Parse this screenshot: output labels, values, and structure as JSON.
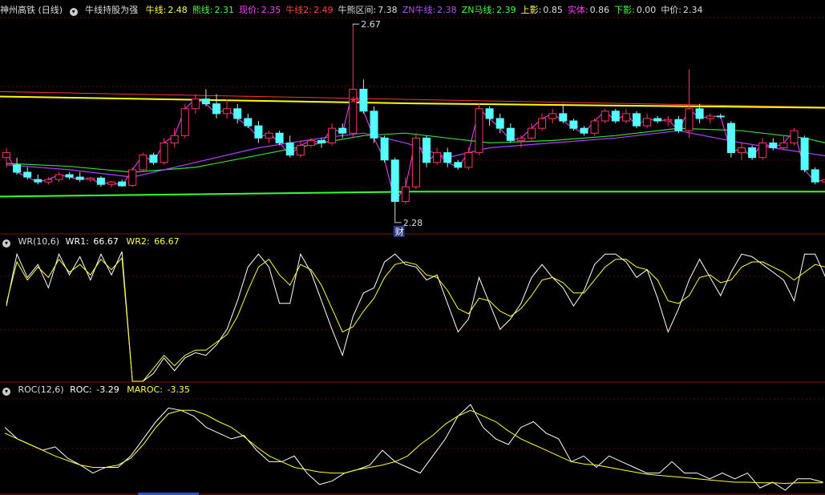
{
  "main_legend": {
    "stock_name": "神州高铁 (日线)",
    "indicator_name": "牛线持股为强",
    "items": [
      {
        "label": "牛线:",
        "value": "2.48",
        "label_color": "#ffff40",
        "value_color": "#ffff40"
      },
      {
        "label": "熊线:",
        "value": "2.31",
        "label_color": "#40ff40",
        "value_color": "#40ff40"
      },
      {
        "label": "现价:",
        "value": "2.35",
        "label_color": "#ff40ff",
        "value_color": "#ff40ff"
      },
      {
        "label": "牛线2:",
        "value": "2.49",
        "label_color": "#ff4040",
        "value_color": "#ff4040"
      },
      {
        "label": "牛熊区间:",
        "value": "7.38",
        "label_color": "#dddddd",
        "value_color": "#dddddd"
      },
      {
        "label": "ZN牛线:",
        "value": "2.38",
        "label_color": "#b050ff",
        "value_color": "#b050ff"
      },
      {
        "label": "ZN马线:",
        "value": "2.39",
        "label_color": "#40ff40",
        "value_color": "#40ff40"
      },
      {
        "label": "上影:",
        "value": "0.85",
        "label_color": "#ffff40",
        "value_color": "#dddddd"
      },
      {
        "label": "实体:",
        "value": "0.86",
        "label_color": "#ff40ff",
        "value_color": "#dddddd"
      },
      {
        "label": "下影:",
        "value": "0.00",
        "label_color": "#40ff40",
        "value_color": "#dddddd"
      },
      {
        "label": "中价:",
        "value": "2.34",
        "label_color": "#dddddd",
        "value_color": "#dddddd"
      }
    ],
    "high_marker": "2.67",
    "low_marker": "2.28",
    "low_tag": "财"
  },
  "wr_legend": {
    "name": "WR(10,6)",
    "wr1_label": "WR1:",
    "wr1_value": "66.67",
    "wr2_label": "WR2:",
    "wr2_value": "66.67"
  },
  "roc_legend": {
    "name": "ROC(12,6)",
    "roc_label": "ROC:",
    "roc_value": "-3.29",
    "maroc_label": "MAROC:",
    "maroc_value": "-3.35"
  },
  "colors": {
    "up": "#ff3366",
    "down": "#54ffff",
    "bull": "#ffff00",
    "bull2": "#ff3333",
    "bear": "#33ff33",
    "zn_bull": "#b040ff",
    "zn_horse": "#33dd33",
    "wr1": "#ffffff",
    "wr2": "#ffff33",
    "roc": "#ffffff",
    "maroc": "#ffff33"
  },
  "chart_data": [
    {
      "type": "candlestick",
      "ylim": [
        2.26,
        2.69
      ],
      "candles": [
        [
          2.4,
          2.42,
          2.38,
          2.41
        ],
        [
          2.385,
          2.4,
          2.365,
          2.37
        ],
        [
          2.37,
          2.38,
          2.355,
          2.36
        ],
        [
          2.355,
          2.365,
          2.345,
          2.35
        ],
        [
          2.35,
          2.36,
          2.345,
          2.355
        ],
        [
          2.355,
          2.37,
          2.35,
          2.365
        ],
        [
          2.365,
          2.37,
          2.355,
          2.36
        ],
        [
          2.36,
          2.37,
          2.35,
          2.355
        ],
        [
          2.355,
          2.36,
          2.35,
          2.358
        ],
        [
          2.358,
          2.362,
          2.34,
          2.345
        ],
        [
          2.345,
          2.352,
          2.338,
          2.35
        ],
        [
          2.35,
          2.355,
          2.34,
          2.342
        ],
        [
          2.343,
          2.38,
          2.34,
          2.375
        ],
        [
          2.375,
          2.41,
          2.37,
          2.405
        ],
        [
          2.405,
          2.41,
          2.385,
          2.39
        ],
        [
          2.39,
          2.44,
          2.385,
          2.43
        ],
        [
          2.43,
          2.46,
          2.42,
          2.445
        ],
        [
          2.445,
          2.51,
          2.44,
          2.5
        ],
        [
          2.5,
          2.53,
          2.49,
          2.52
        ],
        [
          2.52,
          2.54,
          2.505,
          2.51
        ],
        [
          2.51,
          2.53,
          2.48,
          2.49
        ],
        [
          2.49,
          2.52,
          2.48,
          2.5
        ],
        [
          2.5,
          2.51,
          2.47,
          2.48
        ],
        [
          2.48,
          2.49,
          2.46,
          2.465
        ],
        [
          2.465,
          2.475,
          2.43,
          2.44
        ],
        [
          2.44,
          2.455,
          2.43,
          2.45
        ],
        [
          2.45,
          2.455,
          2.425,
          2.43
        ],
        [
          2.43,
          2.445,
          2.4,
          2.405
        ],
        [
          2.405,
          2.435,
          2.4,
          2.425
        ],
        [
          2.425,
          2.44,
          2.42,
          2.435
        ],
        [
          2.435,
          2.44,
          2.42,
          2.43
        ],
        [
          2.43,
          2.47,
          2.425,
          2.46
        ],
        [
          2.46,
          2.47,
          2.44,
          2.45
        ],
        [
          2.45,
          2.67,
          2.44,
          2.54
        ],
        [
          2.54,
          2.56,
          2.49,
          2.495
        ],
        [
          2.495,
          2.505,
          2.43,
          2.44
        ],
        [
          2.44,
          2.445,
          2.39,
          2.395
        ],
        [
          2.395,
          2.4,
          2.28,
          2.31
        ],
        [
          2.31,
          2.36,
          2.305,
          2.34
        ],
        [
          2.34,
          2.45,
          2.335,
          2.44
        ],
        [
          2.44,
          2.445,
          2.38,
          2.39
        ],
        [
          2.39,
          2.42,
          2.385,
          2.41
        ],
        [
          2.41,
          2.42,
          2.38,
          2.39
        ],
        [
          2.39,
          2.395,
          2.375,
          2.38
        ],
        [
          2.38,
          2.42,
          2.375,
          2.41
        ],
        [
          2.41,
          2.51,
          2.405,
          2.5
        ],
        [
          2.5,
          2.505,
          2.465,
          2.48
        ],
        [
          2.48,
          2.49,
          2.45,
          2.46
        ],
        [
          2.46,
          2.47,
          2.43,
          2.435
        ],
        [
          2.435,
          2.445,
          2.42,
          2.44
        ],
        [
          2.44,
          2.47,
          2.435,
          2.46
        ],
        [
          2.46,
          2.49,
          2.455,
          2.48
        ],
        [
          2.48,
          2.5,
          2.47,
          2.49
        ],
        [
          2.49,
          2.51,
          2.47,
          2.475
        ],
        [
          2.475,
          2.48,
          2.455,
          2.46
        ],
        [
          2.46,
          2.465,
          2.445,
          2.45
        ],
        [
          2.45,
          2.48,
          2.445,
          2.475
        ],
        [
          2.475,
          2.5,
          2.47,
          2.495
        ],
        [
          2.495,
          2.5,
          2.47,
          2.475
        ],
        [
          2.475,
          2.5,
          2.47,
          2.49
        ],
        [
          2.49,
          2.495,
          2.46,
          2.465
        ],
        [
          2.465,
          2.49,
          2.46,
          2.48
        ],
        [
          2.48,
          2.485,
          2.47,
          2.475
        ],
        [
          2.475,
          2.485,
          2.465,
          2.478
        ],
        [
          2.478,
          2.485,
          2.45,
          2.455
        ],
        [
          2.455,
          2.58,
          2.44,
          2.5
        ],
        [
          2.5,
          2.51,
          2.47,
          2.48
        ],
        [
          2.48,
          2.49,
          2.47,
          2.485
        ],
        [
          2.485,
          2.49,
          2.48,
          2.484
        ],
        [
          2.47,
          2.475,
          2.4,
          2.41
        ],
        [
          2.41,
          2.43,
          2.395,
          2.42
        ],
        [
          2.42,
          2.425,
          2.395,
          2.4
        ],
        [
          2.4,
          2.44,
          2.395,
          2.43
        ],
        [
          2.43,
          2.44,
          2.415,
          2.42
        ],
        [
          2.42,
          2.445,
          2.415,
          2.43
        ],
        [
          2.43,
          2.46,
          2.425,
          2.455
        ],
        [
          2.44,
          2.445,
          2.37,
          2.375
        ],
        [
          2.375,
          2.38,
          2.345,
          2.35
        ],
        [
          2.35,
          2.36,
          2.345,
          2.355
        ],
        [
          2.355,
          2.4,
          2.35,
          2.38
        ]
      ],
      "bull_line": [
        2.525,
        2.511,
        2.502
      ],
      "bull_line2": [
        2.535,
        2.519,
        2.503
      ],
      "bear_line": [
        2.32,
        2.33,
        2.33
      ],
      "zn_bull_points": [
        [
          0,
          2.385
        ],
        [
          6,
          2.375
        ],
        [
          12,
          2.36
        ],
        [
          18,
          2.39
        ],
        [
          24,
          2.42
        ],
        [
          30,
          2.44
        ],
        [
          34,
          2.45
        ],
        [
          38,
          2.43
        ],
        [
          42,
          2.4
        ],
        [
          46,
          2.42
        ],
        [
          52,
          2.43
        ],
        [
          58,
          2.44
        ],
        [
          64,
          2.455
        ],
        [
          70,
          2.43
        ],
        [
          76,
          2.41
        ],
        [
          79,
          2.4
        ]
      ],
      "zn_horse_points": [
        [
          0,
          2.388
        ],
        [
          6,
          2.382
        ],
        [
          12,
          2.37
        ],
        [
          18,
          2.38
        ],
        [
          24,
          2.405
        ],
        [
          30,
          2.43
        ],
        [
          34,
          2.445
        ],
        [
          38,
          2.45
        ],
        [
          42,
          2.44
        ],
        [
          46,
          2.43
        ],
        [
          52,
          2.435
        ],
        [
          58,
          2.445
        ],
        [
          64,
          2.46
        ],
        [
          70,
          2.455
        ],
        [
          76,
          2.44
        ],
        [
          79,
          2.425
        ]
      ]
    },
    {
      "type": "line",
      "ylim": [
        0,
        100
      ],
      "series": [
        {
          "name": "WR1",
          "values": [
            58,
            98,
            80,
            90,
            72,
            98,
            82,
            96,
            78,
            98,
            82,
            100,
            0,
            0,
            6,
            18,
            8,
            18,
            22,
            20,
            28,
            40,
            62,
            88,
            98,
            88,
            60,
            60,
            98,
            84,
            62,
            40,
            20,
            50,
            68,
            72,
            92,
            98,
            90,
            88,
            78,
            82,
            60,
            38,
            48,
            80,
            60,
            40,
            48,
            60,
            80,
            90,
            80,
            72,
            58,
            70,
            90,
            98,
            98,
            92,
            80,
            86,
            64,
            38,
            56,
            78,
            94,
            80,
            66,
            84,
            98,
            96,
            90,
            84,
            78,
            62,
            98,
            98,
            80,
            70
          ]
        },
        {
          "name": "WR2",
          "values": [
            60,
            92,
            78,
            88,
            80,
            94,
            84,
            90,
            82,
            94,
            86,
            95,
            0,
            0,
            10,
            20,
            12,
            20,
            24,
            24,
            30,
            36,
            50,
            70,
            88,
            94,
            82,
            74,
            90,
            86,
            74,
            56,
            38,
            42,
            54,
            64,
            80,
            90,
            92,
            90,
            82,
            80,
            70,
            56,
            52,
            64,
            62,
            54,
            50,
            56,
            66,
            78,
            80,
            76,
            68,
            68,
            78,
            88,
            94,
            94,
            88,
            86,
            78,
            62,
            60,
            66,
            80,
            82,
            76,
            78,
            88,
            92,
            92,
            88,
            84,
            78,
            84,
            90,
            88,
            80
          ]
        }
      ]
    },
    {
      "type": "line",
      "ylim": [
        -4,
        4
      ],
      "series": [
        {
          "name": "ROC",
          "values": [
            1.5,
            0.5,
            0.0,
            -0.5,
            -0.2,
            -1.2,
            -1.8,
            -2.5,
            -2.0,
            -2.0,
            -1.0,
            0.5,
            2.0,
            3.2,
            3.0,
            2.5,
            1.5,
            1.0,
            0.5,
            0.8,
            -0.5,
            -1.5,
            -1.5,
            -1.0,
            -2.5,
            -3.5,
            -3.2,
            -2.5,
            -2.2,
            -1.8,
            -0.5,
            -1.5,
            -2.0,
            -2.5,
            -1.0,
            0.5,
            2.5,
            3.5,
            1.5,
            0.5,
            0.0,
            1.5,
            2.0,
            1.0,
            0.5,
            -1.5,
            -1.0,
            -2.0,
            -1.0,
            -1.5,
            -2.0,
            -2.5,
            -2.5,
            -1.5,
            -2.5,
            -2.5,
            -3.0,
            -2.5,
            -3.0,
            -2.5,
            -3.8,
            -3.3,
            -4.0,
            -3.0,
            -3.0,
            -3.3
          ]
        },
        {
          "name": "MAROC",
          "values": [
            1.0,
            0.5,
            0.0,
            -0.5,
            -1.0,
            -1.4,
            -1.8,
            -2.0,
            -2.0,
            -1.8,
            -1.2,
            0.0,
            1.5,
            2.7,
            3.0,
            3.0,
            2.6,
            2.0,
            1.5,
            0.7,
            -0.2,
            -1.0,
            -1.5,
            -2.0,
            -2.2,
            -2.4,
            -2.5,
            -2.5,
            -2.2,
            -2.0,
            -1.8,
            -1.5,
            -1.0,
            0.0,
            0.8,
            1.8,
            2.5,
            3.0,
            2.5,
            2.0,
            1.2,
            0.5,
            0.0,
            -0.5,
            -1.0,
            -1.5,
            -1.7,
            -1.8,
            -2.0,
            -2.2,
            -2.4,
            -2.6,
            -2.7,
            -2.8,
            -2.9,
            -3.0,
            -3.1,
            -3.2,
            -3.3,
            -3.3,
            -3.35,
            -3.35,
            -3.4,
            -3.35,
            -3.35,
            -3.35
          ]
        }
      ]
    }
  ]
}
